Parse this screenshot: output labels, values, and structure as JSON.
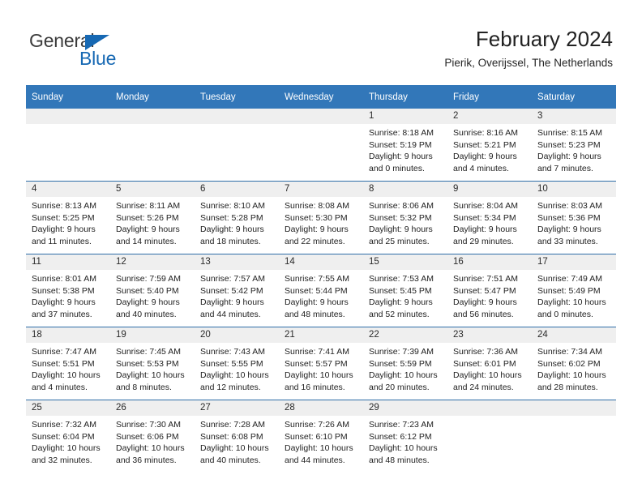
{
  "brand": {
    "name_part1": "General",
    "name_part2": "Blue",
    "accent_color": "#1668b3"
  },
  "header": {
    "title": "February 2024",
    "subtitle": "Pierik, Overijssel, The Netherlands"
  },
  "theme": {
    "header_bg": "#3277b9",
    "daynum_bg": "#efefef",
    "week_divider": "#2f6ea8"
  },
  "weekdays": [
    "Sunday",
    "Monday",
    "Tuesday",
    "Wednesday",
    "Thursday",
    "Friday",
    "Saturday"
  ],
  "weeks": [
    [
      {
        "day": "",
        "lines": []
      },
      {
        "day": "",
        "lines": []
      },
      {
        "day": "",
        "lines": []
      },
      {
        "day": "",
        "lines": []
      },
      {
        "day": "1",
        "lines": [
          "Sunrise: 8:18 AM",
          "Sunset: 5:19 PM",
          "Daylight: 9 hours",
          "and 0 minutes."
        ]
      },
      {
        "day": "2",
        "lines": [
          "Sunrise: 8:16 AM",
          "Sunset: 5:21 PM",
          "Daylight: 9 hours",
          "and 4 minutes."
        ]
      },
      {
        "day": "3",
        "lines": [
          "Sunrise: 8:15 AM",
          "Sunset: 5:23 PM",
          "Daylight: 9 hours",
          "and 7 minutes."
        ]
      }
    ],
    [
      {
        "day": "4",
        "lines": [
          "Sunrise: 8:13 AM",
          "Sunset: 5:25 PM",
          "Daylight: 9 hours",
          "and 11 minutes."
        ]
      },
      {
        "day": "5",
        "lines": [
          "Sunrise: 8:11 AM",
          "Sunset: 5:26 PM",
          "Daylight: 9 hours",
          "and 14 minutes."
        ]
      },
      {
        "day": "6",
        "lines": [
          "Sunrise: 8:10 AM",
          "Sunset: 5:28 PM",
          "Daylight: 9 hours",
          "and 18 minutes."
        ]
      },
      {
        "day": "7",
        "lines": [
          "Sunrise: 8:08 AM",
          "Sunset: 5:30 PM",
          "Daylight: 9 hours",
          "and 22 minutes."
        ]
      },
      {
        "day": "8",
        "lines": [
          "Sunrise: 8:06 AM",
          "Sunset: 5:32 PM",
          "Daylight: 9 hours",
          "and 25 minutes."
        ]
      },
      {
        "day": "9",
        "lines": [
          "Sunrise: 8:04 AM",
          "Sunset: 5:34 PM",
          "Daylight: 9 hours",
          "and 29 minutes."
        ]
      },
      {
        "day": "10",
        "lines": [
          "Sunrise: 8:03 AM",
          "Sunset: 5:36 PM",
          "Daylight: 9 hours",
          "and 33 minutes."
        ]
      }
    ],
    [
      {
        "day": "11",
        "lines": [
          "Sunrise: 8:01 AM",
          "Sunset: 5:38 PM",
          "Daylight: 9 hours",
          "and 37 minutes."
        ]
      },
      {
        "day": "12",
        "lines": [
          "Sunrise: 7:59 AM",
          "Sunset: 5:40 PM",
          "Daylight: 9 hours",
          "and 40 minutes."
        ]
      },
      {
        "day": "13",
        "lines": [
          "Sunrise: 7:57 AM",
          "Sunset: 5:42 PM",
          "Daylight: 9 hours",
          "and 44 minutes."
        ]
      },
      {
        "day": "14",
        "lines": [
          "Sunrise: 7:55 AM",
          "Sunset: 5:44 PM",
          "Daylight: 9 hours",
          "and 48 minutes."
        ]
      },
      {
        "day": "15",
        "lines": [
          "Sunrise: 7:53 AM",
          "Sunset: 5:45 PM",
          "Daylight: 9 hours",
          "and 52 minutes."
        ]
      },
      {
        "day": "16",
        "lines": [
          "Sunrise: 7:51 AM",
          "Sunset: 5:47 PM",
          "Daylight: 9 hours",
          "and 56 minutes."
        ]
      },
      {
        "day": "17",
        "lines": [
          "Sunrise: 7:49 AM",
          "Sunset: 5:49 PM",
          "Daylight: 10 hours",
          "and 0 minutes."
        ]
      }
    ],
    [
      {
        "day": "18",
        "lines": [
          "Sunrise: 7:47 AM",
          "Sunset: 5:51 PM",
          "Daylight: 10 hours",
          "and 4 minutes."
        ]
      },
      {
        "day": "19",
        "lines": [
          "Sunrise: 7:45 AM",
          "Sunset: 5:53 PM",
          "Daylight: 10 hours",
          "and 8 minutes."
        ]
      },
      {
        "day": "20",
        "lines": [
          "Sunrise: 7:43 AM",
          "Sunset: 5:55 PM",
          "Daylight: 10 hours",
          "and 12 minutes."
        ]
      },
      {
        "day": "21",
        "lines": [
          "Sunrise: 7:41 AM",
          "Sunset: 5:57 PM",
          "Daylight: 10 hours",
          "and 16 minutes."
        ]
      },
      {
        "day": "22",
        "lines": [
          "Sunrise: 7:39 AM",
          "Sunset: 5:59 PM",
          "Daylight: 10 hours",
          "and 20 minutes."
        ]
      },
      {
        "day": "23",
        "lines": [
          "Sunrise: 7:36 AM",
          "Sunset: 6:01 PM",
          "Daylight: 10 hours",
          "and 24 minutes."
        ]
      },
      {
        "day": "24",
        "lines": [
          "Sunrise: 7:34 AM",
          "Sunset: 6:02 PM",
          "Daylight: 10 hours",
          "and 28 minutes."
        ]
      }
    ],
    [
      {
        "day": "25",
        "lines": [
          "Sunrise: 7:32 AM",
          "Sunset: 6:04 PM",
          "Daylight: 10 hours",
          "and 32 minutes."
        ]
      },
      {
        "day": "26",
        "lines": [
          "Sunrise: 7:30 AM",
          "Sunset: 6:06 PM",
          "Daylight: 10 hours",
          "and 36 minutes."
        ]
      },
      {
        "day": "27",
        "lines": [
          "Sunrise: 7:28 AM",
          "Sunset: 6:08 PM",
          "Daylight: 10 hours",
          "and 40 minutes."
        ]
      },
      {
        "day": "28",
        "lines": [
          "Sunrise: 7:26 AM",
          "Sunset: 6:10 PM",
          "Daylight: 10 hours",
          "and 44 minutes."
        ]
      },
      {
        "day": "29",
        "lines": [
          "Sunrise: 7:23 AM",
          "Sunset: 6:12 PM",
          "Daylight: 10 hours",
          "and 48 minutes."
        ]
      },
      {
        "day": "",
        "lines": []
      },
      {
        "day": "",
        "lines": []
      }
    ]
  ]
}
